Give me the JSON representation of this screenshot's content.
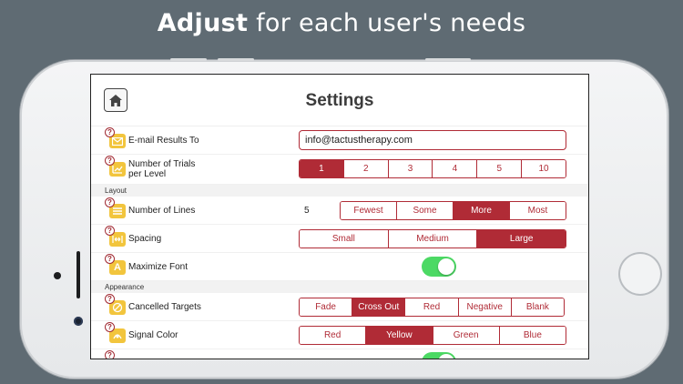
{
  "headline": {
    "bold": "Adjust",
    "rest": "for each user's needs"
  },
  "app": {
    "title": "Settings"
  },
  "rows": {
    "email": {
      "label": "E-mail Results To",
      "value": "info@tactustherapy.com",
      "help": "?"
    },
    "trials": {
      "label_line1": "Number of Trials",
      "label_line2": "per Level",
      "help": "?",
      "options": [
        "1",
        "2",
        "3",
        "4",
        "5",
        "10"
      ],
      "selected": "1"
    },
    "lines": {
      "label": "Number of Lines",
      "value": "5",
      "help": "?",
      "options": [
        "Fewest",
        "Some",
        "More",
        "Most"
      ],
      "selected": "More"
    },
    "spacing": {
      "label": "Spacing",
      "help": "?",
      "options": [
        "Small",
        "Medium",
        "Large"
      ],
      "selected": "Large"
    },
    "maximize": {
      "label": "Maximize Font",
      "help": "?",
      "toggle_on": true
    },
    "cancelled": {
      "label": "Cancelled Targets",
      "help": "?",
      "options": [
        "Fade",
        "Cross Out",
        "Red",
        "Negative",
        "Blank"
      ],
      "selected": "Cross Out"
    },
    "signal": {
      "label": "Signal Color",
      "help": "?",
      "options": [
        "Red",
        "Yellow",
        "Green",
        "Blue"
      ],
      "selected": "Yellow"
    },
    "next": {
      "help": "?",
      "toggle_on": true
    }
  },
  "sections": {
    "layout": "Layout",
    "appearance": "Appearance"
  },
  "colors": {
    "accent": "#b02b36",
    "icon_yellow": "#f2c53d",
    "toggle_on": "#4cd964",
    "background": "#5f6b73"
  },
  "icons": {
    "home": "home-icon",
    "email": "envelope-icon",
    "trials": "trials-icon",
    "lines": "lines-icon",
    "spacing": "spacing-icon",
    "maximize": "font-size-icon",
    "cancelled": "cancel-icon",
    "signal": "signal-color-icon"
  }
}
